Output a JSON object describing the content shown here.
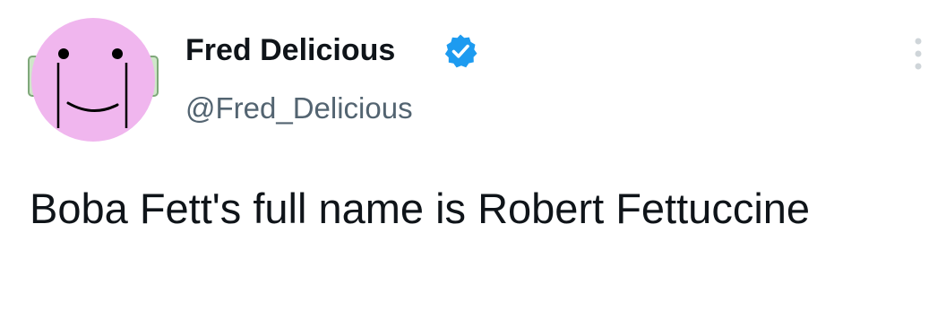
{
  "tweet": {
    "display_name": "Fred Delicious",
    "handle": "@Fred_Delicious",
    "text": "Boba Fett's full name is Robert Fettuccine",
    "verified": true
  },
  "icons": {
    "avatar": "pink-smiley-face-avatar",
    "verified": "verified-badge-icon",
    "more": "more-options-icon"
  },
  "colors": {
    "avatar_background": "#f0b6ee",
    "verified_badge": "#1d9bf0",
    "handle_text": "#536471",
    "body_text": "#0f1419"
  }
}
